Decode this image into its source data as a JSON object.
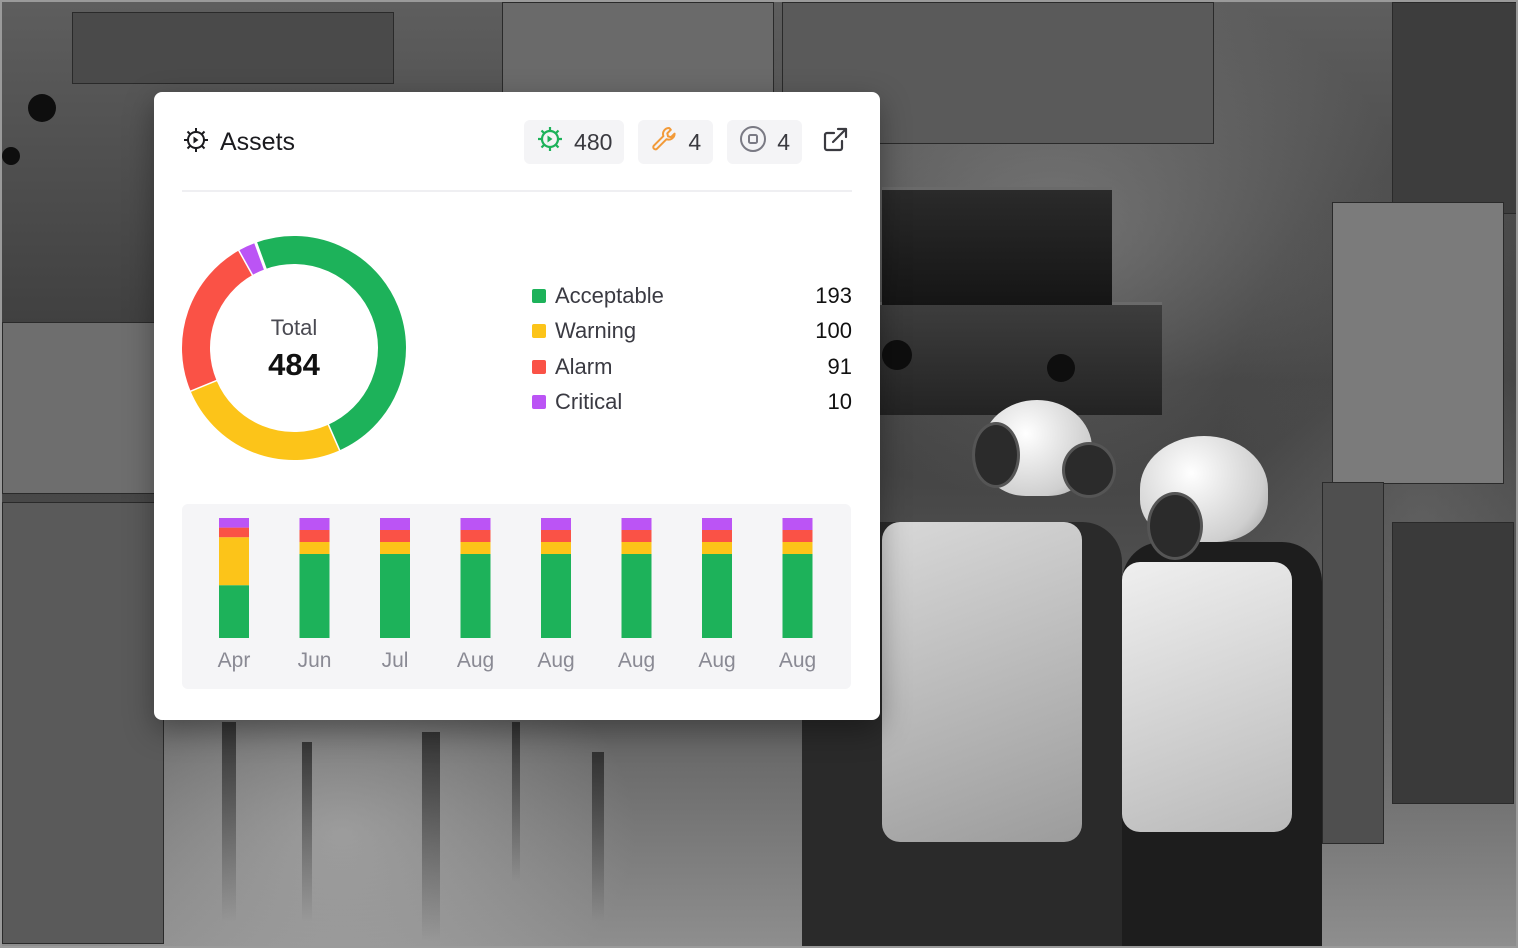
{
  "card": {
    "title": "Assets",
    "chips": [
      {
        "icon": "gear-check-icon",
        "value": "480",
        "color": "#1db25a"
      },
      {
        "icon": "wrench-icon",
        "value": "4",
        "color": "#f29a38"
      },
      {
        "icon": "stop-circle-icon",
        "value": "4",
        "color": "#7a7a84"
      }
    ],
    "external_icon": "external-link-icon"
  },
  "donut": {
    "label": "Total",
    "total": "484"
  },
  "legend": [
    {
      "name": "Acceptable",
      "value": "193",
      "color": "#1db25a"
    },
    {
      "name": "Warning",
      "value": "100",
      "color": "#fcc419"
    },
    {
      "name": "Alarm",
      "value": "91",
      "color": "#fa5246"
    },
    {
      "name": "Critical",
      "value": "10",
      "color": "#bb54f5"
    }
  ],
  "chart_data": [
    {
      "type": "pie",
      "categories": [
        "Acceptable",
        "Warning",
        "Alarm",
        "Critical"
      ],
      "values": [
        193,
        100,
        91,
        10
      ],
      "colors": [
        "#1db25a",
        "#fcc419",
        "#fa5246",
        "#bb54f5"
      ],
      "title": "",
      "center_label": "Total",
      "center_value": 484
    },
    {
      "type": "bar",
      "stacked": true,
      "categories": [
        "Apr",
        "Jun",
        "Jul",
        "Aug",
        "Aug",
        "Aug",
        "Aug",
        "Aug"
      ],
      "series": [
        {
          "name": "Acceptable",
          "color": "#1db25a",
          "values": [
            44,
            70,
            70,
            70,
            70,
            70,
            70,
            70
          ]
        },
        {
          "name": "Warning",
          "color": "#fcc419",
          "values": [
            40,
            10,
            10,
            10,
            10,
            10,
            10,
            10
          ]
        },
        {
          "name": "Alarm",
          "color": "#fa5246",
          "values": [
            8,
            10,
            10,
            10,
            10,
            10,
            10,
            10
          ]
        },
        {
          "name": "Critical",
          "color": "#bb54f5",
          "values": [
            8,
            10,
            10,
            10,
            10,
            10,
            10,
            10
          ]
        }
      ],
      "ylim": [
        0,
        100
      ],
      "grid": false,
      "legend": "none"
    }
  ]
}
